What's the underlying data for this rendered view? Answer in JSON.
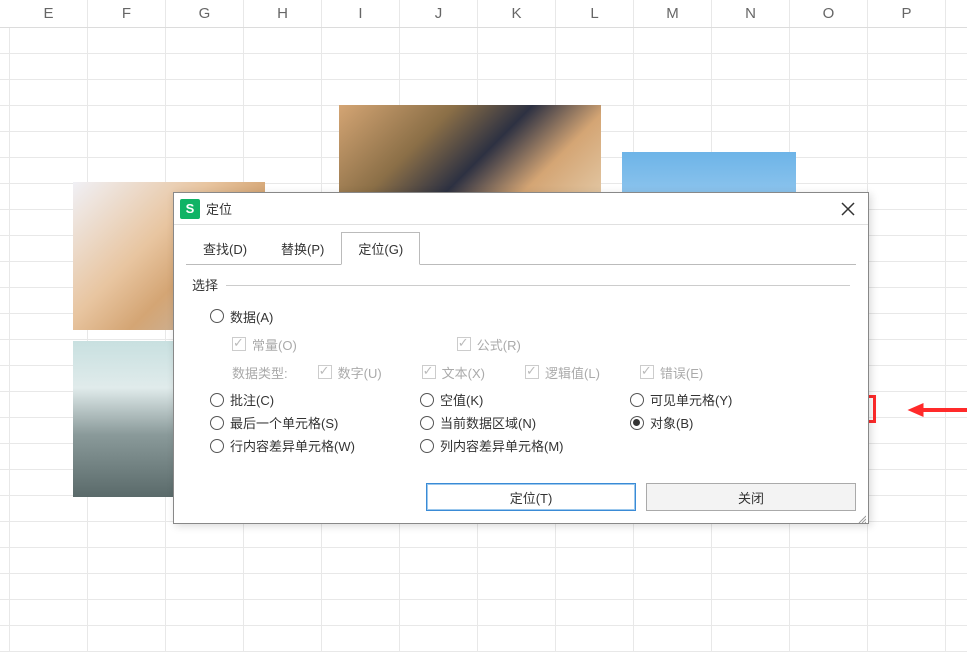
{
  "columns": [
    "E",
    "F",
    "G",
    "H",
    "I",
    "J",
    "K",
    "L",
    "M",
    "N",
    "O",
    "P"
  ],
  "dialog": {
    "title": "定位",
    "tabs": [
      {
        "label": "查找(D)"
      },
      {
        "label": "替换(P)"
      },
      {
        "label": "定位(G)",
        "active": true
      }
    ],
    "section_label": "选择",
    "radios": {
      "data": "数据(A)",
      "comments": "批注(C)",
      "blanks": "空值(K)",
      "visible": "可见单元格(Y)",
      "last_cell": "最后一个单元格(S)",
      "cur_region": "当前数据区域(N)",
      "objects": "对象(B)",
      "row_diff": "行内容差异单元格(W)",
      "col_diff": "列内容差异单元格(M)"
    },
    "checks": {
      "const": "常量(O)",
      "formula": "公式(R)",
      "type_label": "数据类型:",
      "number": "数字(U)",
      "text": "文本(X)",
      "logic": "逻辑值(L)",
      "error": "错误(E)"
    },
    "buttons": {
      "locate": "定位(T)",
      "close": "关闭"
    }
  }
}
